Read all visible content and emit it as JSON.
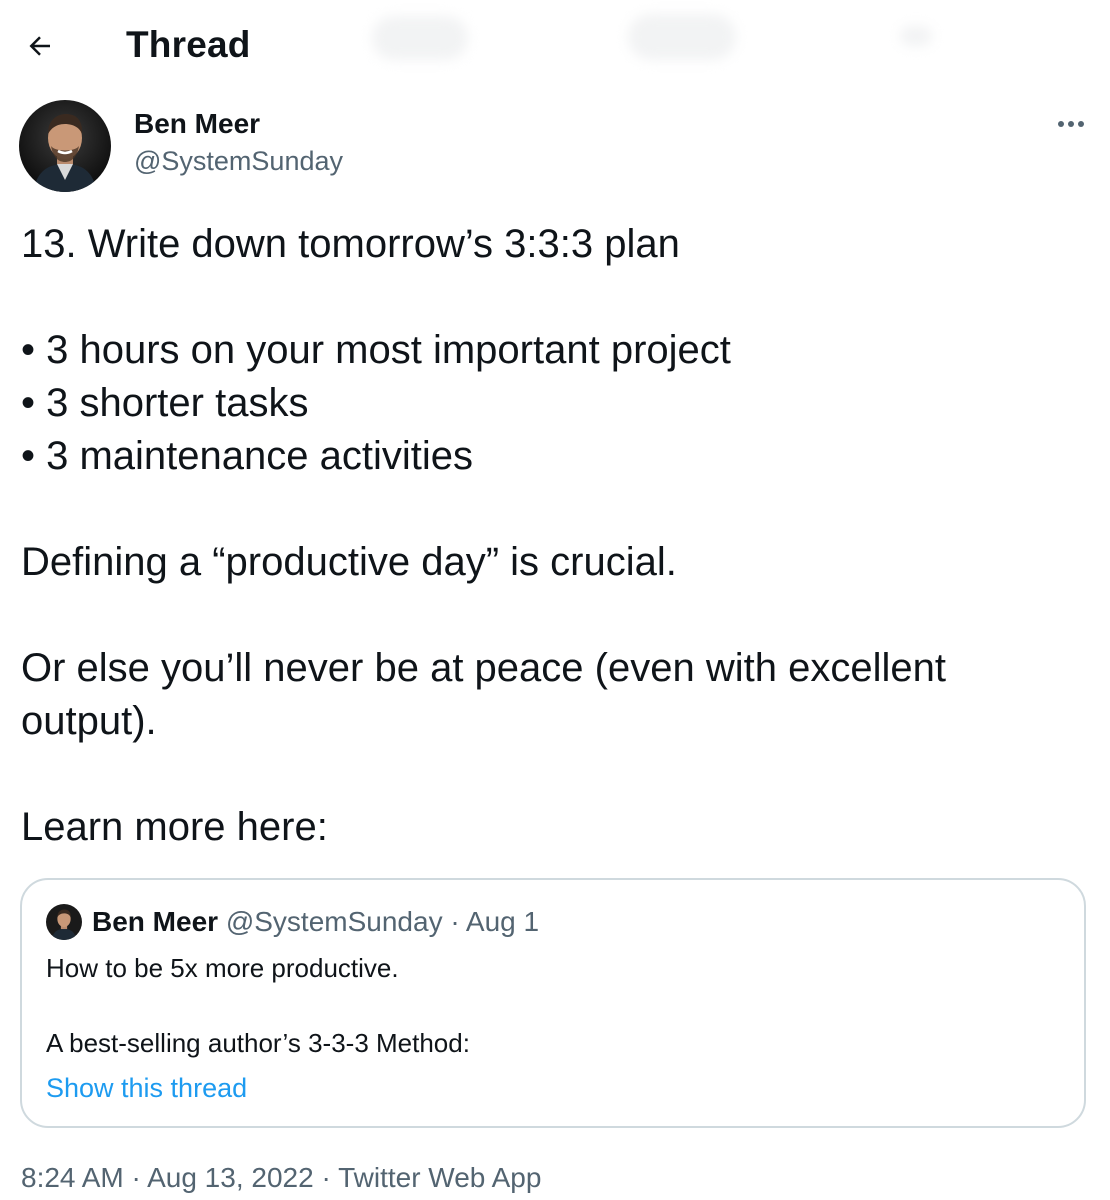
{
  "header": {
    "title": "Thread",
    "back_icon": "arrow-left-icon"
  },
  "author": {
    "name": "Ben Meer",
    "handle": "@SystemSunday",
    "more_icon": "more-horizontal-icon"
  },
  "tweet": {
    "line1": "13. Write down tomorrow’s 3:3:3 plan",
    "bullets": [
      "• 3 hours on your most important project",
      "• 3 shorter tasks",
      "• 3 maintenance activities"
    ],
    "line2": "Defining a “productive day” is crucial.",
    "line3": "Or else you’ll never be at peace (even with excellent output).",
    "line4": "Learn more here:"
  },
  "quote": {
    "name": "Ben Meer",
    "handle": "@SystemSunday",
    "separator": "·",
    "date": "Aug 1",
    "line1": "How to be 5x more productive.",
    "line2": "A best-selling author’s 3-3-3 Method:",
    "link": "Show this thread"
  },
  "meta": {
    "time": "8:24 AM",
    "separator": "·",
    "date": "Aug 13, 2022",
    "source": "Twitter Web App"
  },
  "colors": {
    "text": "#0f1419",
    "secondary": "#536471",
    "link": "#1d9bf0",
    "border": "#cfd9de"
  }
}
